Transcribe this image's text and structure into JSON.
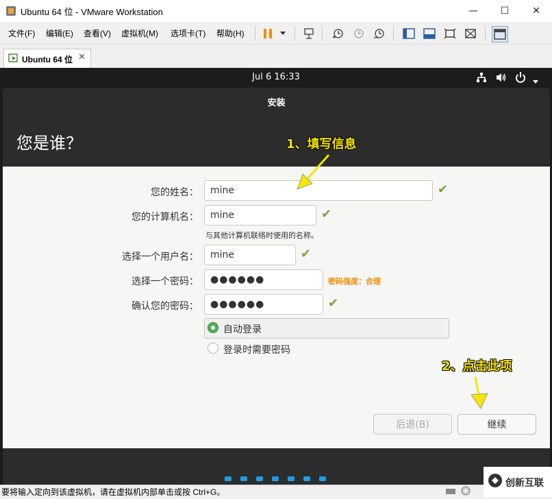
{
  "window": {
    "title": "Ubuntu 64 位 - VMware Workstation",
    "minimize_glyph": "—",
    "maximize_glyph": "☐",
    "close_glyph": "✕"
  },
  "menu": {
    "items": [
      "文件(F)",
      "编辑(E)",
      "查看(V)",
      "虚拟机(M)",
      "选项卡(T)",
      "帮助(H)"
    ]
  },
  "tab": {
    "label": "Ubuntu 64 位",
    "close": "✕"
  },
  "ubuntu": {
    "clock": "Jul 6  16:33"
  },
  "installer": {
    "title": "安装",
    "heading": "您是谁？",
    "fields": [
      {
        "label": "您的姓名：",
        "value": "mine"
      },
      {
        "label": "您的计算机名：",
        "value": "mine"
      },
      {
        "label": "选择一个用户名：",
        "value": "mine"
      },
      {
        "label": "选择一个密码：",
        "value": "●●●●●●"
      },
      {
        "label": "确认您的密码：",
        "value": "●●●●●●"
      }
    ],
    "computer_name_hint": "与其他计算机联络时使用的名称。",
    "password_strength": "密码强度：合理",
    "login_options": [
      {
        "label": "自动登录",
        "selected": true
      },
      {
        "label": "登录时需要密码",
        "selected": false
      }
    ],
    "back_button": "后退(B)",
    "continue_button": "继续",
    "progress": {
      "total_steps": 7
    }
  },
  "annotations": {
    "step1": "1、填写信息",
    "step2": "2、点击此项"
  },
  "status_bar": {
    "text": "要将输入定向到该虚拟机，请在虚拟机内部单击或按 Ctrl+G。"
  },
  "watermark": {
    "text": "创新互联"
  },
  "colors": {
    "accent_orange": "#f08c00",
    "check_green": "#7aa33b",
    "radio_green": "#4caf50",
    "progress_blue": "#1e9ce6",
    "annotation_yellow": "#f6e500"
  }
}
